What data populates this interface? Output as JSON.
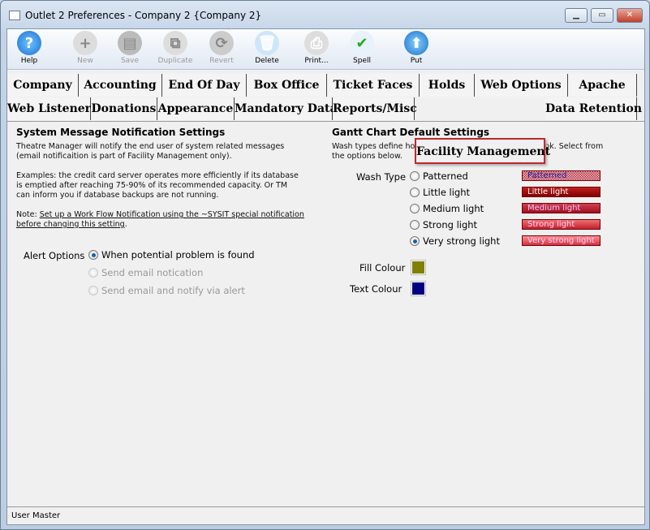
{
  "window": {
    "title": "Outlet 2 Preferences - Company 2 {Company 2}",
    "minimize": "▁",
    "maximize": "▭",
    "close": "✕"
  },
  "toolbar": [
    {
      "label": "Help",
      "icon": "help-icon",
      "glyph": "?",
      "enabled": true
    },
    {
      "label": "New",
      "icon": "new-icon",
      "glyph": "+",
      "enabled": false
    },
    {
      "label": "Save",
      "icon": "save-icon",
      "glyph": "▤",
      "enabled": false
    },
    {
      "label": "Duplicate",
      "icon": "duplicate-icon",
      "glyph": "⧉",
      "enabled": false
    },
    {
      "label": "Revert",
      "icon": "revert-icon",
      "glyph": "⟳",
      "enabled": false
    },
    {
      "label": "Delete",
      "icon": "delete-icon",
      "glyph": "🗑",
      "enabled": true
    },
    {
      "label": "Print...",
      "icon": "print-icon",
      "glyph": "⎙",
      "enabled": true
    },
    {
      "label": "Spell",
      "icon": "spell-icon",
      "glyph": "✔",
      "enabled": true
    },
    {
      "label": "Put",
      "icon": "put-icon",
      "glyph": "⬆",
      "enabled": true
    }
  ],
  "tabs_row1": [
    "Company",
    "Accounting",
    "End Of Day",
    "Box Office",
    "Ticket Faces",
    "Holds",
    "Web Options",
    "Apache"
  ],
  "tabs_row2": [
    "Web Listener",
    "Donations",
    "Appearance",
    "Mandatory Data",
    "Reports/Misc",
    "Facility Management",
    "Data Retention"
  ],
  "selected_tab": "Facility Management",
  "left": {
    "heading": "System Message Notification Settings",
    "intro1": "Theatre Manager will notify the end user of system related messages",
    "intro2": "(email notificaition is part of Facility Management only).",
    "ex1": "Examples:  the credit card server operates more efficiently if its database",
    "ex2": "is emptied after reaching 75-90% of its recommended capacity.  Or TM",
    "ex3": "can inform you if database backups are not running.",
    "note_prefix": "Note: ",
    "note_link1": "Set up a Work Flow Notification using the ~SYSIT special notification",
    "note_link2": "before changing this setting",
    "note_suffix": ".",
    "alert_label": "Alert Options",
    "alert_options": [
      {
        "label": "When potential problem is found",
        "selected": true,
        "enabled": true
      },
      {
        "label": "Send email notication",
        "selected": false,
        "enabled": false
      },
      {
        "label": "Send email and notify via alert",
        "selected": false,
        "enabled": false
      }
    ]
  },
  "right": {
    "heading": "Gantt Chart Default Settings",
    "desc1": "Wash types define how the bars on a gantt chart will look.  Select from",
    "desc2": "the options below.",
    "wash_label": "Wash Type",
    "wash_types": [
      {
        "label": "Patterned",
        "selected": false
      },
      {
        "label": "Little light",
        "selected": false
      },
      {
        "label": "Medium light",
        "selected": false
      },
      {
        "label": "Strong light",
        "selected": false
      },
      {
        "label": "Very strong light",
        "selected": true
      }
    ],
    "fill_label": "Fill Colour",
    "fill_color": "#808000",
    "text_label": "Text Colour",
    "text_color": "#000080"
  },
  "status": {
    "user": "User Master"
  }
}
